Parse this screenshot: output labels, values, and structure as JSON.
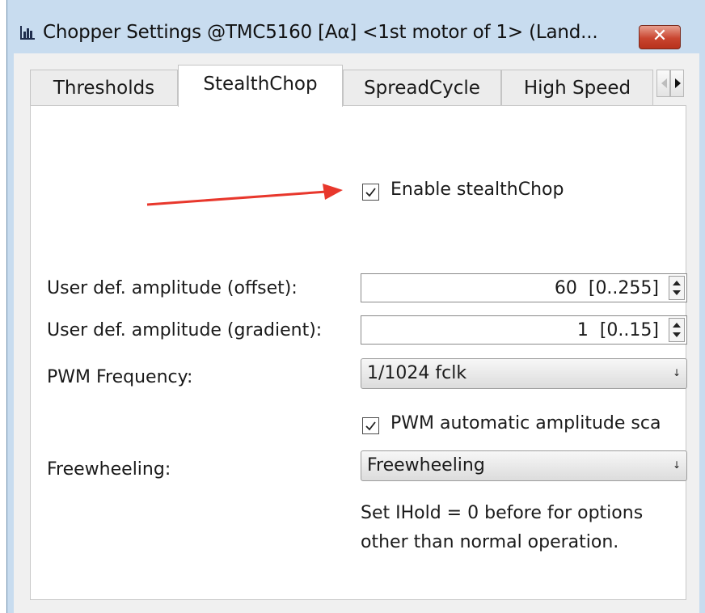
{
  "window": {
    "title": "Chopper Settings @TMC5160 [Aα] <1st motor of 1> (Land...",
    "close_label": "✕",
    "app_icon": "bar-chart-icon"
  },
  "tabs": [
    {
      "label": "Thresholds",
      "active": false
    },
    {
      "label": "StealthChop",
      "active": true
    },
    {
      "label": "SpreadCycle",
      "active": false
    },
    {
      "label": "High Speed",
      "active": false
    }
  ],
  "stealthchop": {
    "enable_label": "Enable stealthChop",
    "enable_checked": true,
    "offset_label": "User def. amplitude (offset):",
    "offset_value": "60  [0..255]",
    "gradient_label": "User def. amplitude (gradient):",
    "gradient_value": "1  [0..15]",
    "pwm_freq_label": "PWM Frequency:",
    "pwm_freq_value": "1/1024 fclk",
    "autoscale_label": "PWM automatic amplitude sca",
    "autoscale_checked": true,
    "freewheel_label": "Freewheeling:",
    "freewheel_value": "Freewheeling",
    "note_line1": "Set IHold = 0 before for options",
    "note_line2": "other than normal operation."
  },
  "annotation": {
    "arrow_color": "#e8372c"
  }
}
